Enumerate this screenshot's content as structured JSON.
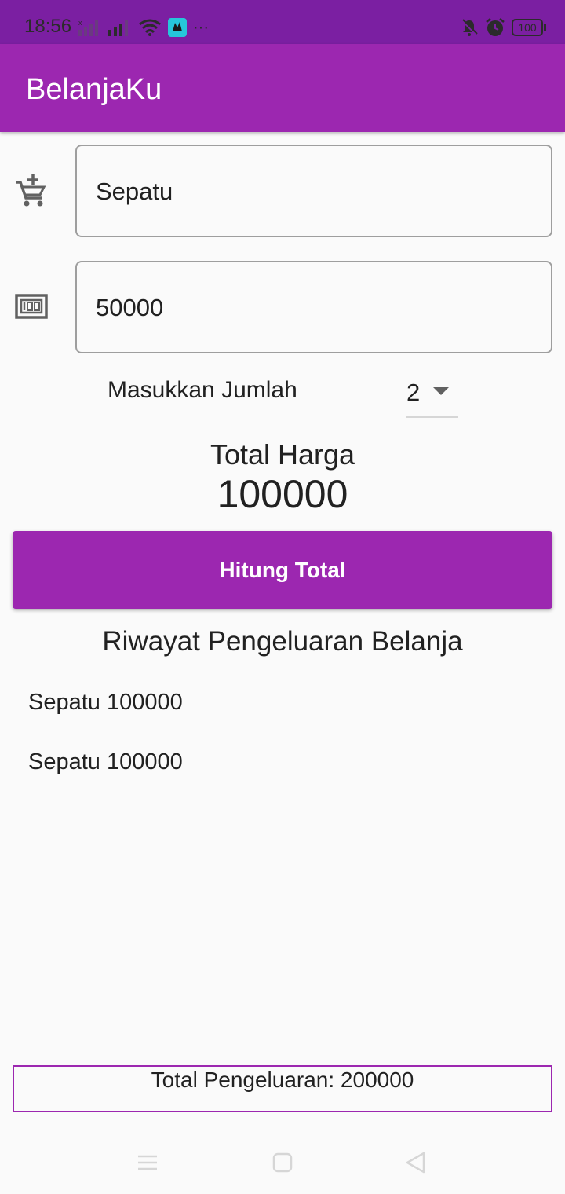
{
  "status_bar": {
    "time": "18:56",
    "battery": "100"
  },
  "app_bar": {
    "title": "BelanjaKu"
  },
  "form": {
    "item_name": {
      "icon": "add-shopping-cart-icon",
      "value": "Sepatu"
    },
    "price": {
      "icon": "money-icon",
      "value": "50000"
    },
    "quantity": {
      "label": "Masukkan Jumlah",
      "selected": "2"
    }
  },
  "total": {
    "label": "Total Harga",
    "value": "100000"
  },
  "calc_button": {
    "label": "Hitung Total"
  },
  "history": {
    "title": "Riwayat Pengeluaran Belanja",
    "items": [
      "Sepatu 100000",
      "Sepatu 100000"
    ]
  },
  "spending": {
    "label": "Total Pengeluaran: 200000"
  },
  "colors": {
    "primary": "#9c27b0",
    "status_bar": "#7b1fa2",
    "background": "#fafafa"
  }
}
